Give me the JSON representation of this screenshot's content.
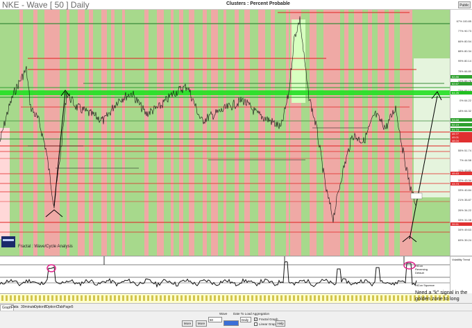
{
  "window": {
    "title": "NKE - Wave [ 50 ] Daily",
    "chart_title": "Clusters : Percent Probable",
    "public_label": "Public"
  },
  "legend": {
    "text": "Fractal : Wave/Cycle Analysis"
  },
  "annotation": {
    "text": "Need a \"k\" signal in the golden zone to long squeeze"
  },
  "oscillator": {
    "top_label": "Volatility Trend",
    "label_1": "HiCon Reversing Default",
    "label_2": "HiCon Squeeze"
  },
  "price_axis": {
    "labels": [
      "67% 100.85",
      "77% 90.73",
      "66% 80.54",
      "88% 80.34",
      "99% 80.14",
      "78% 66.80",
      "12% 65.78",
      "73% 65.12",
      "0% 64.22",
      "18% 64.32",
      "28% 53.74",
      "81% 54.92",
      "28% 52.85",
      "55% 51.74",
      "7% 44.58",
      "11% 43.81",
      "32% 43.34",
      "33% 40.84",
      "21% 35.87",
      "26% 34.22",
      "33% 31.08",
      "34% 49.63",
      "69% 39.24"
    ],
    "badges": [
      {
        "label": "62.86",
        "color": "#2fa12f"
      },
      {
        "label": "62.67",
        "color": "#2fa12f"
      },
      {
        "label": "64.26",
        "color": "#22c022"
      },
      {
        "label": "53.68",
        "color": "#2fa12f"
      },
      {
        "label": "52.19",
        "color": "#2fa12f"
      },
      {
        "label": "51.74",
        "color": "#2fa12f"
      },
      {
        "label": "49.77",
        "color": "#e03030"
      },
      {
        "label": "49.01",
        "color": "#e03030"
      },
      {
        "label": "48.04",
        "color": "#e03030"
      },
      {
        "label": "45.63",
        "color": "#e03030"
      },
      {
        "label": "43.73",
        "color": "#e03030"
      },
      {
        "label": "39.51",
        "color": "#e03030"
      }
    ]
  },
  "tabs": [
    {
      "label": "Graph",
      "active": true
    },
    {
      "label": "Data",
      "active": false
    },
    {
      "label": "30minute",
      "active": false
    },
    {
      "label": "OptionB",
      "active": false
    },
    {
      "label": "OptionC",
      "active": false
    },
    {
      "label": "TabPage5",
      "active": false
    }
  ],
  "controls": {
    "wave_label": "Wave",
    "wave_value": "50",
    "date_label": "Date To Load Aggregation",
    "date_value": "",
    "period_value": "Daily",
    "fractal_label": "Fractal Graph",
    "linear_label": "Linear Graph",
    "more_label_1": "More",
    "more_label_2": "More",
    "help_label": "Help"
  },
  "colors": {
    "green_zone": "#b8f0a0",
    "red_zone": "#f2a6a6",
    "golden_band": "#22e022",
    "price_line": "#111111",
    "resistance": "#e02020"
  }
}
